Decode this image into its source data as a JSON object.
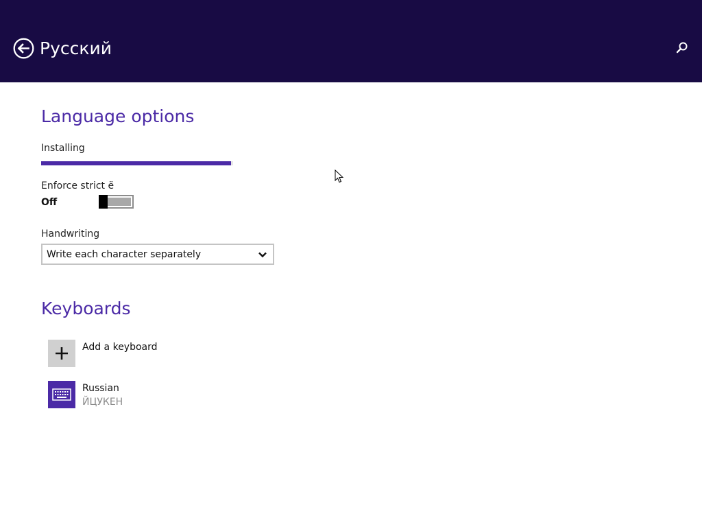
{
  "header": {
    "title": "Русский",
    "back_icon": "back-arrow-circle-icon",
    "search_icon": "search-icon",
    "background_color": "#180b44"
  },
  "language_options": {
    "title": "Language options",
    "install": {
      "status_label": "Installing",
      "progress_fraction": 0.99
    },
    "enforce_strict": {
      "label": "Enforce strict ё",
      "state_label": "Off",
      "is_on": false
    },
    "handwriting": {
      "label": "Handwriting",
      "selected_value": "Write each character separately"
    }
  },
  "keyboards": {
    "title": "Keyboards",
    "add_label": "Add a keyboard",
    "items": [
      {
        "name": "Russian",
        "layout": "ЙЦУКЕН",
        "icon": "keyboard-icon"
      }
    ]
  },
  "colors": {
    "accent": "#4b2aa6",
    "header_bg": "#180b44"
  }
}
